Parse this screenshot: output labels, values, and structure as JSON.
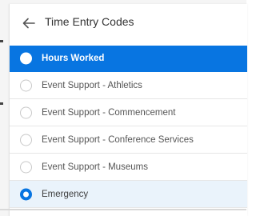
{
  "header": {
    "title": "Time Entry Codes",
    "back_icon": "arrow-left-icon"
  },
  "options": [
    {
      "label": "Hours Worked",
      "state": "highlighted"
    },
    {
      "label": "Event Support - Athletics",
      "state": "unchecked"
    },
    {
      "label": "Event Support - Commencement",
      "state": "unchecked"
    },
    {
      "label": "Event Support - Conference Services",
      "state": "unchecked"
    },
    {
      "label": "Event Support - Museums",
      "state": "unchecked"
    },
    {
      "label": "Emergency",
      "state": "checked"
    }
  ],
  "colors": {
    "accent": "#0875e1",
    "selected_row": "#eaf3fb",
    "text": "#555555"
  }
}
